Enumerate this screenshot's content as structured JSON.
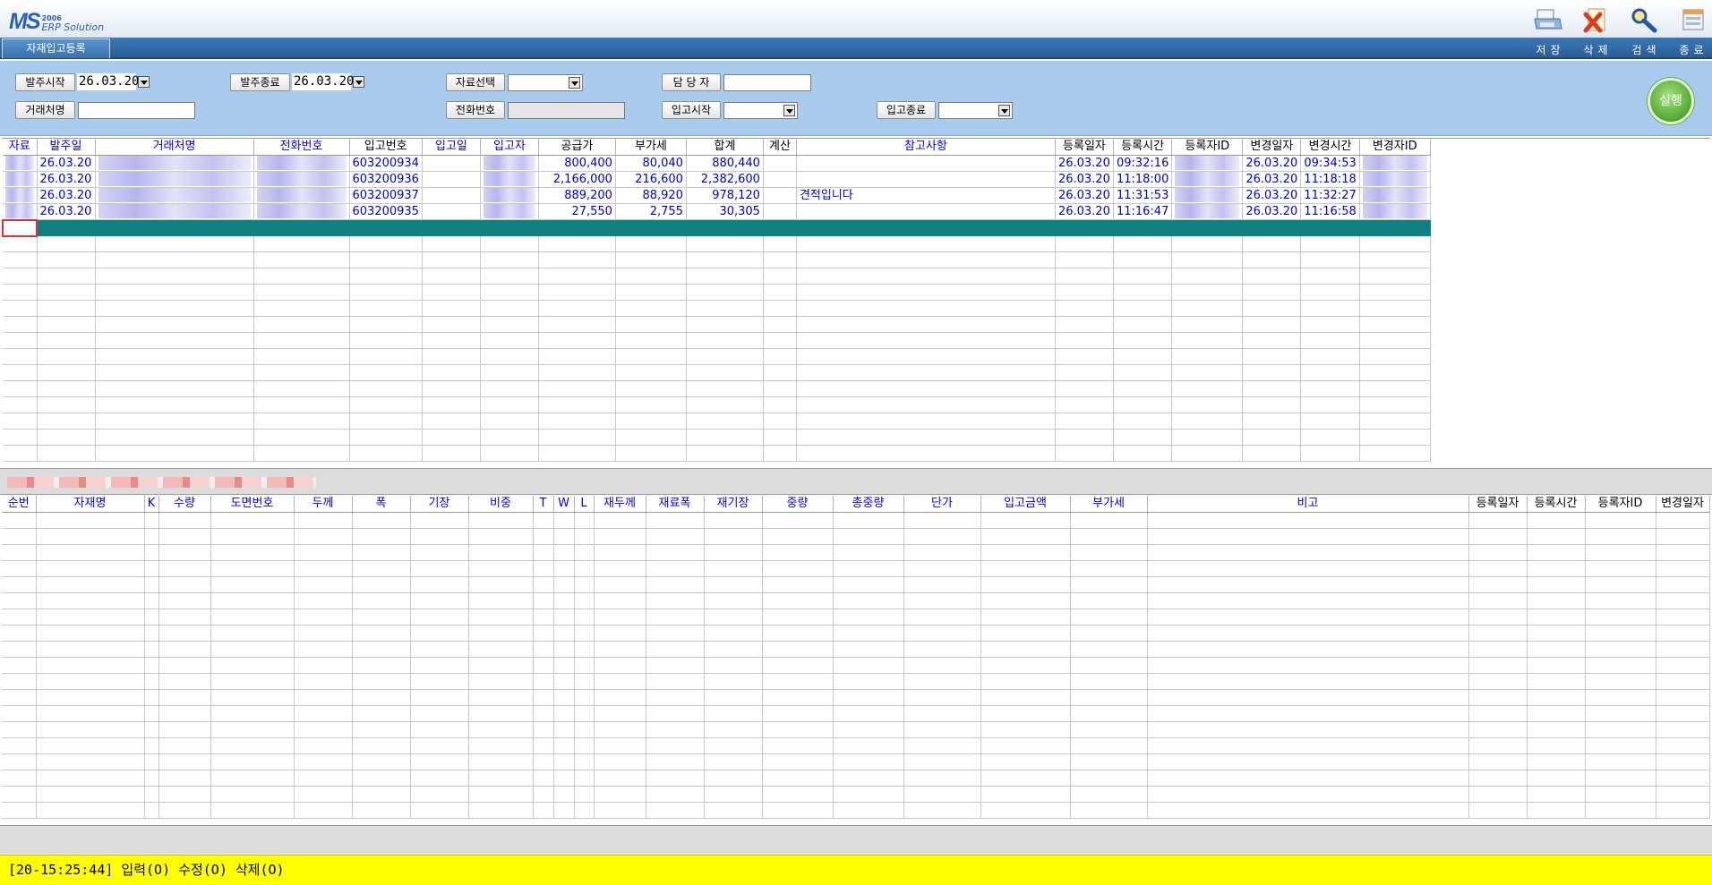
{
  "app": {
    "logo_mark": "MS",
    "logo_year": "2006",
    "logo_text": "ERP Solution",
    "tab": "자재입고등록"
  },
  "toolbar": {
    "save": "저장",
    "delete": "삭제",
    "search": "검색",
    "exit": "종료"
  },
  "filters": {
    "order_start_label": "발주시작",
    "order_start_value": "26.03.20",
    "order_end_label": "발주종료",
    "order_end_value": "26.03.20",
    "data_select_label": "자료선택",
    "manager_label": "담 당 자",
    "client_label": "거래처명",
    "phone_label": "전화번호",
    "receipt_start_label": "입고시작",
    "receipt_end_label": "입고종료",
    "run_label": "실행"
  },
  "grid1": {
    "columns": [
      {
        "label": "자료",
        "blue": true
      },
      {
        "label": "발주일",
        "blue": true
      },
      {
        "label": "거래처명",
        "blue": true
      },
      {
        "label": "전화번호",
        "blue": true
      },
      {
        "label": "입고번호",
        "blue": false
      },
      {
        "label": "입고일",
        "blue": true
      },
      {
        "label": "입고자",
        "blue": true
      },
      {
        "label": "공급가",
        "blue": false
      },
      {
        "label": "부가세",
        "blue": false
      },
      {
        "label": "합계",
        "blue": false
      },
      {
        "label": "계산",
        "blue": false
      },
      {
        "label": "참고사항",
        "blue": true
      },
      {
        "label": "등록일자",
        "blue": false
      },
      {
        "label": "등록시간",
        "blue": false
      },
      {
        "label": "등록자ID",
        "blue": false
      },
      {
        "label": "변경일자",
        "blue": false
      },
      {
        "label": "변경시간",
        "blue": false
      },
      {
        "label": "변경자ID",
        "blue": false
      }
    ],
    "rows": [
      {
        "order_date": "26.03.20",
        "receipt_no": "603200934",
        "supply": "800,400",
        "vat": "80,040",
        "total": "880,440",
        "note": "",
        "reg_date": "26.03.20",
        "reg_time": "09:32:16",
        "mod_date": "26.03.20",
        "mod_time": "09:34:53"
      },
      {
        "order_date": "26.03.20",
        "receipt_no": "603200936",
        "supply": "2,166,000",
        "vat": "216,600",
        "total": "2,382,600",
        "note": "",
        "reg_date": "26.03.20",
        "reg_time": "11:18:00",
        "mod_date": "26.03.20",
        "mod_time": "11:18:18"
      },
      {
        "order_date": "26.03.20",
        "receipt_no": "603200937",
        "supply": "889,200",
        "vat": "88,920",
        "total": "978,120",
        "note": "견적입니다",
        "reg_date": "26.03.20",
        "reg_time": "11:31:53",
        "mod_date": "26.03.20",
        "mod_time": "11:32:27"
      },
      {
        "order_date": "26.03.20",
        "receipt_no": "603200935",
        "supply": "27,550",
        "vat": "2,755",
        "total": "30,305",
        "note": "",
        "reg_date": "26.03.20",
        "reg_time": "11:16:47",
        "mod_date": "26.03.20",
        "mod_time": "11:16:58"
      }
    ]
  },
  "grid2": {
    "columns": [
      {
        "label": "순번",
        "blue": true
      },
      {
        "label": "자재명",
        "blue": true
      },
      {
        "label": "K",
        "blue": true
      },
      {
        "label": "수량",
        "blue": true
      },
      {
        "label": "도면번호",
        "blue": true
      },
      {
        "label": "두께",
        "blue": true
      },
      {
        "label": "폭",
        "blue": true
      },
      {
        "label": "기장",
        "blue": true
      },
      {
        "label": "비중",
        "blue": true
      },
      {
        "label": "T",
        "blue": true
      },
      {
        "label": "W",
        "blue": true
      },
      {
        "label": "L",
        "blue": true
      },
      {
        "label": "재두께",
        "blue": true
      },
      {
        "label": "재료폭",
        "blue": true
      },
      {
        "label": "재기장",
        "blue": true
      },
      {
        "label": "중량",
        "blue": true
      },
      {
        "label": "총중량",
        "blue": true
      },
      {
        "label": "단가",
        "blue": true
      },
      {
        "label": "입고금액",
        "blue": true
      },
      {
        "label": "부가세",
        "blue": true
      },
      {
        "label": "비고",
        "blue": true
      },
      {
        "label": "등록일자",
        "blue": false
      },
      {
        "label": "등록시간",
        "blue": false
      },
      {
        "label": "등록자ID",
        "blue": false
      },
      {
        "label": "변경일자",
        "blue": false
      }
    ]
  },
  "status": {
    "text": "[20-15:25:44] 입력(O) 수정(O) 삭제(O)"
  }
}
